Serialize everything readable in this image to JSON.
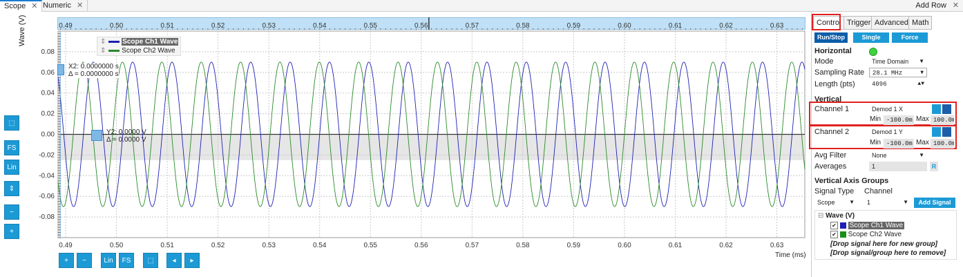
{
  "tabs": [
    {
      "label": "Scope"
    },
    {
      "label": "Numeric"
    }
  ],
  "add_row": "Add Row",
  "plot": {
    "y_axis_label": "Wave (V)",
    "x_axis_label": "Time (ms)",
    "x_ticks": [
      "0.49",
      "0.50",
      "0.51",
      "0.52",
      "0.53",
      "0.54",
      "0.55",
      "0.56",
      "0.57",
      "0.58",
      "0.59",
      "0.60",
      "0.61",
      "0.62",
      "0.63"
    ],
    "x_ticks_bottom": [
      "0.49",
      "0.50",
      "0.51",
      "0.52",
      "0.53",
      "0.54",
      "0.55",
      "0.56",
      "0.57",
      "0.58",
      "0.59",
      "0.60",
      "0.61",
      "0.62",
      "0.63"
    ],
    "y_ticks": [
      "0.08",
      "0.06",
      "0.04",
      "0.02",
      "0.00",
      "-0.02",
      "-0.04",
      "-0.06",
      "-0.08"
    ],
    "legend": [
      {
        "name": "Scope Ch1 Wave",
        "color": "#1f1fb4"
      },
      {
        "name": "Scope Ch2 Wave",
        "color": "#2a8a2a"
      }
    ],
    "x_cursor": {
      "line1": "X2: 0.0000000 s",
      "line2": "Δ = 0.0000000 s"
    },
    "y_cursor": {
      "line1": "Y2: 0.0000 V",
      "line2": "Δ = 0.0000 V"
    },
    "left_buttons": [
      "FS",
      "Lin"
    ],
    "bottom_buttons": [
      "Lin",
      "FS"
    ]
  },
  "chart_data": {
    "type": "line",
    "xlabel": "Time (ms)",
    "ylabel": "Wave (V)",
    "xlim": [
      0.4885,
      0.6355
    ],
    "ylim": [
      -0.1,
      0.1
    ],
    "grid": true,
    "legend_position": "top-left",
    "series": [
      {
        "name": "Scope Ch1 Wave",
        "amplitude": 0.07,
        "period_ms": 0.00775,
        "phase_ms": 0.4935,
        "color": "#1f1fb4"
      },
      {
        "name": "Scope Ch2 Wave",
        "amplitude": 0.07,
        "period_ms": 0.00775,
        "phase_ms": 0.4915,
        "color": "#2a8a2a"
      }
    ]
  },
  "control": {
    "tabs": [
      "Control",
      "Trigger",
      "Advanced",
      "Math"
    ],
    "run_stop": "Run/Stop",
    "single": "Single",
    "force": "Force",
    "horizontal": "Horizontal",
    "mode_label": "Mode",
    "mode_value": "Time Domain",
    "sampling_label": "Sampling Rate",
    "sampling_value": "28.1 MHz",
    "length_label": "Length (pts)",
    "length_value": "4096",
    "vertical": "Vertical",
    "ch1_label": "Channel 1",
    "ch1_value": "Demod 1 X",
    "ch2_label": "Channel 2",
    "ch2_value": "Demod 1 Y",
    "min_label": "Min",
    "max_label": "Max",
    "ch1_min": "-100.0m",
    "ch1_max": "100.0m",
    "ch2_min": "-100.0m",
    "ch2_max": "100.0m",
    "avg_label": "Avg Filter",
    "avg_value": "None",
    "averages_label": "Averages",
    "averages_value": "1",
    "reset_label": "R",
    "vag": "Vertical Axis Groups",
    "signal_type_label": "Signal Type",
    "channel_label": "Channel",
    "signal_type_value": "Scope",
    "channel_value": "1",
    "add_signal": "Add Signal",
    "tree_group": "Wave (V)",
    "tree_items": [
      {
        "name": "Scope Ch1 Wave",
        "color": "#1f1fb4"
      },
      {
        "name": "Scope Ch2 Wave",
        "color": "#1a8f1a"
      }
    ],
    "drop_new": "[Drop signal here for new group]",
    "drop_remove": "[Drop signal/group here to remove]"
  }
}
